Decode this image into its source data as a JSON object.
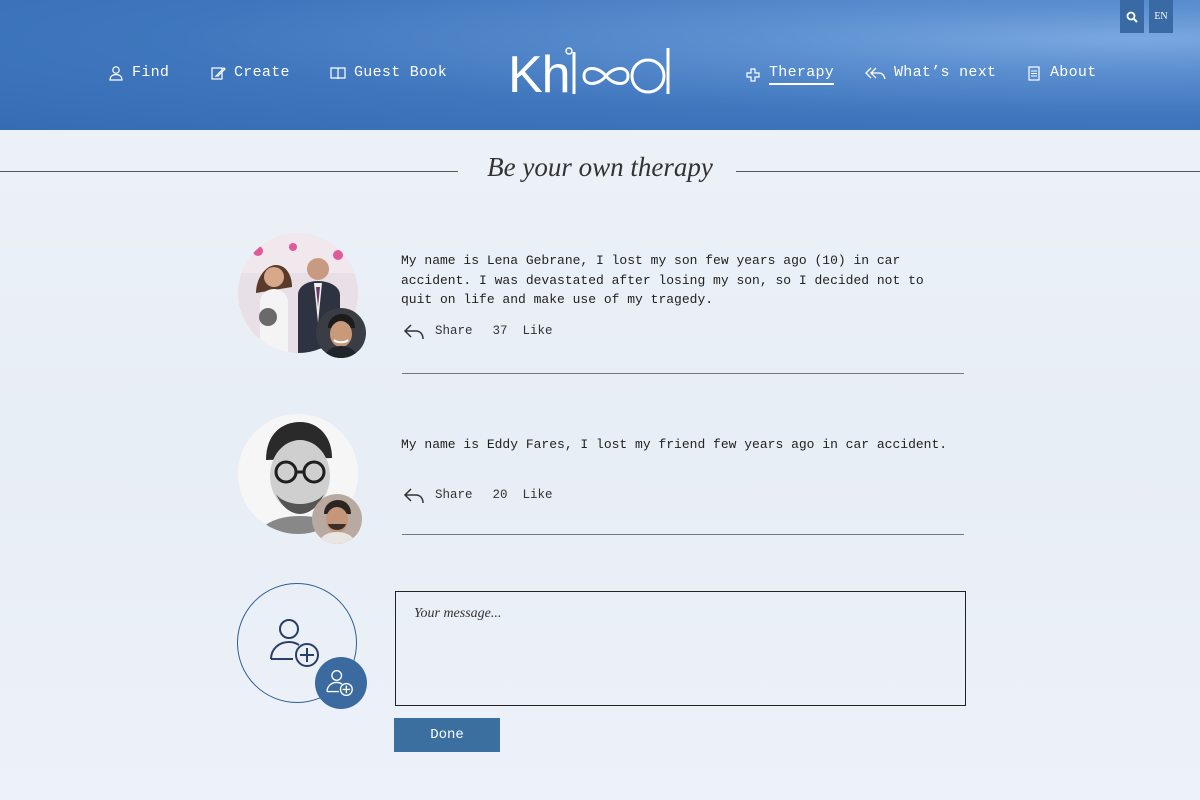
{
  "header": {
    "logo_text": "Khlood",
    "nav_left": [
      {
        "label": "Find",
        "icon": "person-icon"
      },
      {
        "label": "Create",
        "icon": "edit-icon"
      },
      {
        "label": "Guest Book",
        "icon": "book-icon"
      }
    ],
    "nav_right": [
      {
        "label": "Therapy",
        "icon": "plus-icon",
        "active": true
      },
      {
        "label": "What’s next",
        "icon": "reply-all-icon"
      },
      {
        "label": "About",
        "icon": "document-icon"
      }
    ],
    "search_icon": "search-icon",
    "language": "EN"
  },
  "page": {
    "title": "Be your own therapy"
  },
  "posts": [
    {
      "text": "My name is Lena Gebrane, I lost my son few years ago (10) in car accident. I was devastated after losing my son, so I decided not to quit on life and make use of my tragedy.",
      "share_label": "Share",
      "like_count": "37",
      "like_label": "Like"
    },
    {
      "text": "My name is Eddy Fares, I lost my friend few years ago in car accident.",
      "share_label": "Share",
      "like_count": "20",
      "like_label": "Like"
    }
  ],
  "compose": {
    "placeholder": "Your message...",
    "done_label": "Done"
  },
  "colors": {
    "header_blue": "#3f76bd",
    "button_blue": "#3b6fa0",
    "accent": "#2d5e95"
  }
}
